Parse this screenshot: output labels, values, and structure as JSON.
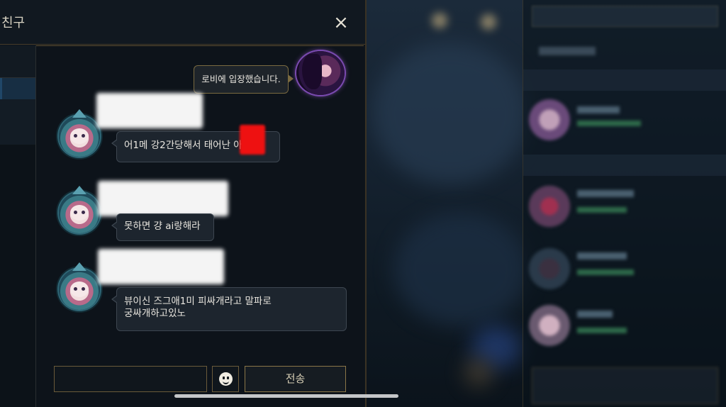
{
  "dialog": {
    "title": "친구",
    "close_icon": "×"
  },
  "self_message": {
    "text": "로비에 입장했습니다."
  },
  "messages": [
    {
      "text": "어1메 강2간당해서 태어난    아"
    },
    {
      "text": "못하면 걍 ai랑해라"
    },
    {
      "text": "뷰이신 즈그애1미 피싸개라고 말파로\n궁싸개하고있노"
    }
  ],
  "composer": {
    "input_value": "",
    "send_label": "전송",
    "emoji_icon": "smiley-icon"
  }
}
